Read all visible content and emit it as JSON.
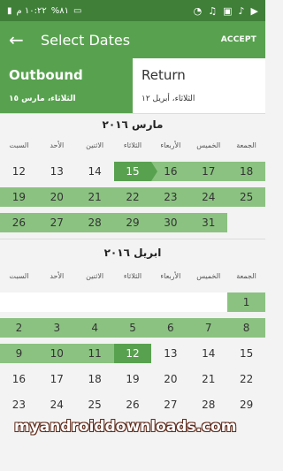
{
  "status": {
    "time": "١٠:٢٢ م",
    "battery": "%٨١",
    "icons": [
      "signal-icon",
      "battery-icon",
      "wifi-icon",
      "headphones-icon",
      "image-icon",
      "play-icon",
      "music-icon"
    ]
  },
  "toolbar": {
    "title": "Select Dates",
    "accept": "ACCEPT"
  },
  "tabs": {
    "outbound": {
      "label": "Outbound",
      "date": "الثلاثاء، مارس ١٥"
    },
    "return": {
      "label": "Return",
      "date": "الثلاثاء، أبريل ١٢"
    }
  },
  "weekdays": [
    "السبت",
    "الأحد",
    "الاثنين",
    "الثلاثاء",
    "الأربعاء",
    "الخميس",
    "الجمعة"
  ],
  "months": [
    {
      "name": "مارس ٢٠١٦",
      "rows": [
        [
          "12",
          "13",
          "14",
          "15",
          "16",
          "17",
          "18"
        ],
        [
          "19",
          "20",
          "21",
          "22",
          "23",
          "24",
          "25"
        ],
        [
          "26",
          "27",
          "28",
          "29",
          "30",
          "31",
          ""
        ]
      ]
    },
    {
      "name": "ابريل ٢٠١٦",
      "rows": [
        [
          "",
          "",
          "",
          "",
          "",
          "",
          "1"
        ],
        [
          "2",
          "3",
          "4",
          "5",
          "6",
          "7",
          "8"
        ],
        [
          "9",
          "10",
          "11",
          "12",
          "13",
          "14",
          "15"
        ],
        [
          "16",
          "17",
          "18",
          "19",
          "20",
          "21",
          "22"
        ],
        [
          "23",
          "24",
          "25",
          "26",
          "27",
          "28",
          "29"
        ]
      ]
    }
  ],
  "watermark": "myandroiddownloads.com",
  "colors": {
    "primary": "#58a24f",
    "range": "#8bc281",
    "statusbar": "#3f7f38"
  }
}
